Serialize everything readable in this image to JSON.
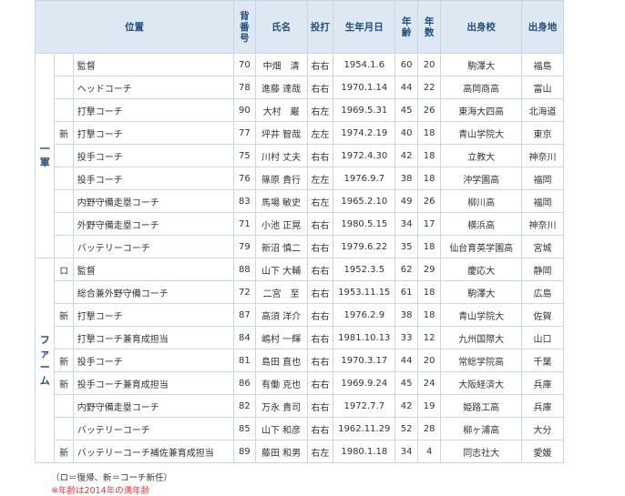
{
  "headers": [
    "位置",
    "背番号",
    "氏名",
    "投打",
    "生年月日",
    "年齢",
    "年数",
    "出身校",
    "出身地"
  ],
  "groups": {
    "first": "一軍",
    "farm": "ファーム"
  },
  "rows": [
    {
      "mark": "",
      "pos": "監督",
      "num": "70",
      "name": "中畑　清",
      "bt": "右右",
      "dob": "1954.1.6",
      "age": "60",
      "yrs": "20",
      "school": "駒澤大",
      "home": "福島"
    },
    {
      "mark": "",
      "pos": "ヘッドコーチ",
      "num": "78",
      "name": "進藤 達哉",
      "bt": "右右",
      "dob": "1970.1.14",
      "age": "44",
      "yrs": "22",
      "school": "高岡商高",
      "home": "富山"
    },
    {
      "mark": "",
      "pos": "打撃コーチ",
      "num": "90",
      "name": "大村　巌",
      "bt": "右左",
      "dob": "1969.5.31",
      "age": "45",
      "yrs": "26",
      "school": "東海大四高",
      "home": "北海道"
    },
    {
      "mark": "新",
      "pos": "打撃コーチ",
      "num": "77",
      "name": "坪井 智哉",
      "bt": "左左",
      "dob": "1974.2.19",
      "age": "40",
      "yrs": "18",
      "school": "青山学院大",
      "home": "東京"
    },
    {
      "mark": "",
      "pos": "投手コーチ",
      "num": "75",
      "name": "川村 丈夫",
      "bt": "右右",
      "dob": "1972.4.30",
      "age": "42",
      "yrs": "18",
      "school": "立教大",
      "home": "神奈川"
    },
    {
      "mark": "",
      "pos": "投手コーチ",
      "num": "76",
      "name": "篠原 貴行",
      "bt": "左左",
      "dob": "1976.9.7",
      "age": "38",
      "yrs": "18",
      "school": "沖学園高",
      "home": "福岡"
    },
    {
      "mark": "",
      "pos": "内野守備走塁コーチ",
      "num": "83",
      "name": "馬場 敏史",
      "bt": "右左",
      "dob": "1965.2.10",
      "age": "49",
      "yrs": "26",
      "school": "柳川高",
      "home": "福岡"
    },
    {
      "mark": "",
      "pos": "外野守備走塁コーチ",
      "num": "71",
      "name": "小池 正晃",
      "bt": "右右",
      "dob": "1980.5.15",
      "age": "34",
      "yrs": "17",
      "school": "横浜高",
      "home": "神奈川"
    },
    {
      "mark": "",
      "pos": "バッテリーコーチ",
      "num": "79",
      "name": "新沼 慎二",
      "bt": "右右",
      "dob": "1979.6.22",
      "age": "35",
      "yrs": "18",
      "school": "仙台育英学園高",
      "home": "宮城"
    },
    {
      "mark": "ロ",
      "pos": "監督",
      "num": "88",
      "name": "山下 大輔",
      "bt": "右右",
      "dob": "1952.3.5",
      "age": "62",
      "yrs": "29",
      "school": "慶応大",
      "home": "静岡"
    },
    {
      "mark": "",
      "pos": "総合兼外野守備コーチ",
      "num": "72",
      "name": "二宮　至",
      "bt": "右右",
      "dob": "1953.11.15",
      "age": "61",
      "yrs": "18",
      "school": "駒澤大",
      "home": "広島"
    },
    {
      "mark": "新",
      "pos": "打撃コーチ",
      "num": "87",
      "name": "高須 洋介",
      "bt": "右右",
      "dob": "1976.2.9",
      "age": "38",
      "yrs": "18",
      "school": "青山学院大",
      "home": "佐賀"
    },
    {
      "mark": "",
      "pos": "打撃コーチ兼育成担当",
      "num": "84",
      "name": "嶋村 一輝",
      "bt": "右右",
      "dob": "1981.10.13",
      "age": "33",
      "yrs": "12",
      "school": "九州国際大",
      "home": "山口"
    },
    {
      "mark": "新",
      "pos": "投手コーチ",
      "num": "81",
      "name": "島田 直也",
      "bt": "右右",
      "dob": "1970.3.17",
      "age": "44",
      "yrs": "20",
      "school": "常総学院高",
      "home": "千葉"
    },
    {
      "mark": "新",
      "pos": "投手コーチ兼育成担当",
      "num": "86",
      "name": "有働 克也",
      "bt": "右右",
      "dob": "1969.9.24",
      "age": "45",
      "yrs": "24",
      "school": "大阪経済大",
      "home": "兵庫"
    },
    {
      "mark": "",
      "pos": "内野守備走塁コーチ",
      "num": "82",
      "name": "万永 貴司",
      "bt": "右右",
      "dob": "1972.7.7",
      "age": "42",
      "yrs": "19",
      "school": "姫路工高",
      "home": "兵庫"
    },
    {
      "mark": "",
      "pos": "バッテリーコーチ",
      "num": "85",
      "name": "山下 和彦",
      "bt": "右右",
      "dob": "1962.11.29",
      "age": "52",
      "yrs": "28",
      "school": "柳ヶ浦高",
      "home": "大分"
    },
    {
      "mark": "新",
      "pos": "バッテリーコーチ補佐兼育成担当",
      "num": "89",
      "name": "藤田 和男",
      "bt": "右左",
      "dob": "1980.1.18",
      "age": "34",
      "yrs": "4",
      "school": "同志社大",
      "home": "愛媛"
    }
  ],
  "notes": {
    "legend": "（ロ＝復帰、新＝コーチ新任）",
    "age_note": "※年齢は2014年の満年齢"
  }
}
